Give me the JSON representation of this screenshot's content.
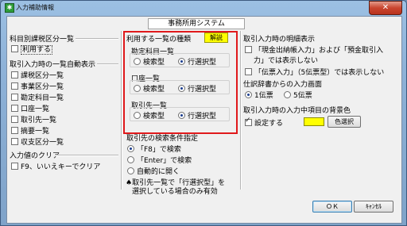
{
  "window": {
    "title": "入力補助情報",
    "close_glyph": "✕"
  },
  "system_label": "事務所用システム",
  "left": {
    "category_heading": "科目別課税区分一覧",
    "use_label": "利用する",
    "auto_heading": "取引入力時の一覧自動表示",
    "auto_items": [
      "課税区分一覧",
      "事業区分一覧",
      "勘定科目一覧",
      "口座一覧",
      "取引先一覧",
      "摘要一覧",
      "収支区分一覧"
    ],
    "clear_heading": "入力値のクリア",
    "clear_item": "F9、いいえキーでクリア"
  },
  "middle": {
    "list_type_heading": "利用する一覧の種類",
    "help_button": "解説",
    "search_type": "検索型",
    "row_type": "行選択型",
    "groups": [
      {
        "title": "勘定科目一覧"
      },
      {
        "title": "口座一覧"
      },
      {
        "title": "取引先一覧"
      }
    ],
    "partner_heading": "取引先の検索条件指定",
    "partner_options": [
      "「F8」で検索",
      "「Enter」で検索",
      "自動的に開く"
    ],
    "note_line1": "♠取引先一覧で「行選択型」を",
    "note_line2": "選択している場合のみ有効"
  },
  "right": {
    "detail_heading": "取引入力時の明細表示",
    "detail_item1_line1": "「現金出納帳入力」および「預金取引入",
    "detail_item1_line2": "力」では表示しない",
    "detail_item2": "「伝票入力」（5伝票型）では表示しない",
    "journal_heading": "仕訳辞書からの入力画面",
    "journal_options": [
      "1伝票",
      "5伝票"
    ],
    "bg_heading": "取引入力時の入力中項目の背景色",
    "bg_setting": "設定する",
    "bg_color": "#ffff00",
    "color_select": "色選択"
  },
  "buttons": {
    "ok": "ＯＫ",
    "cancel": "ｷｬﾝｾﾙ"
  }
}
